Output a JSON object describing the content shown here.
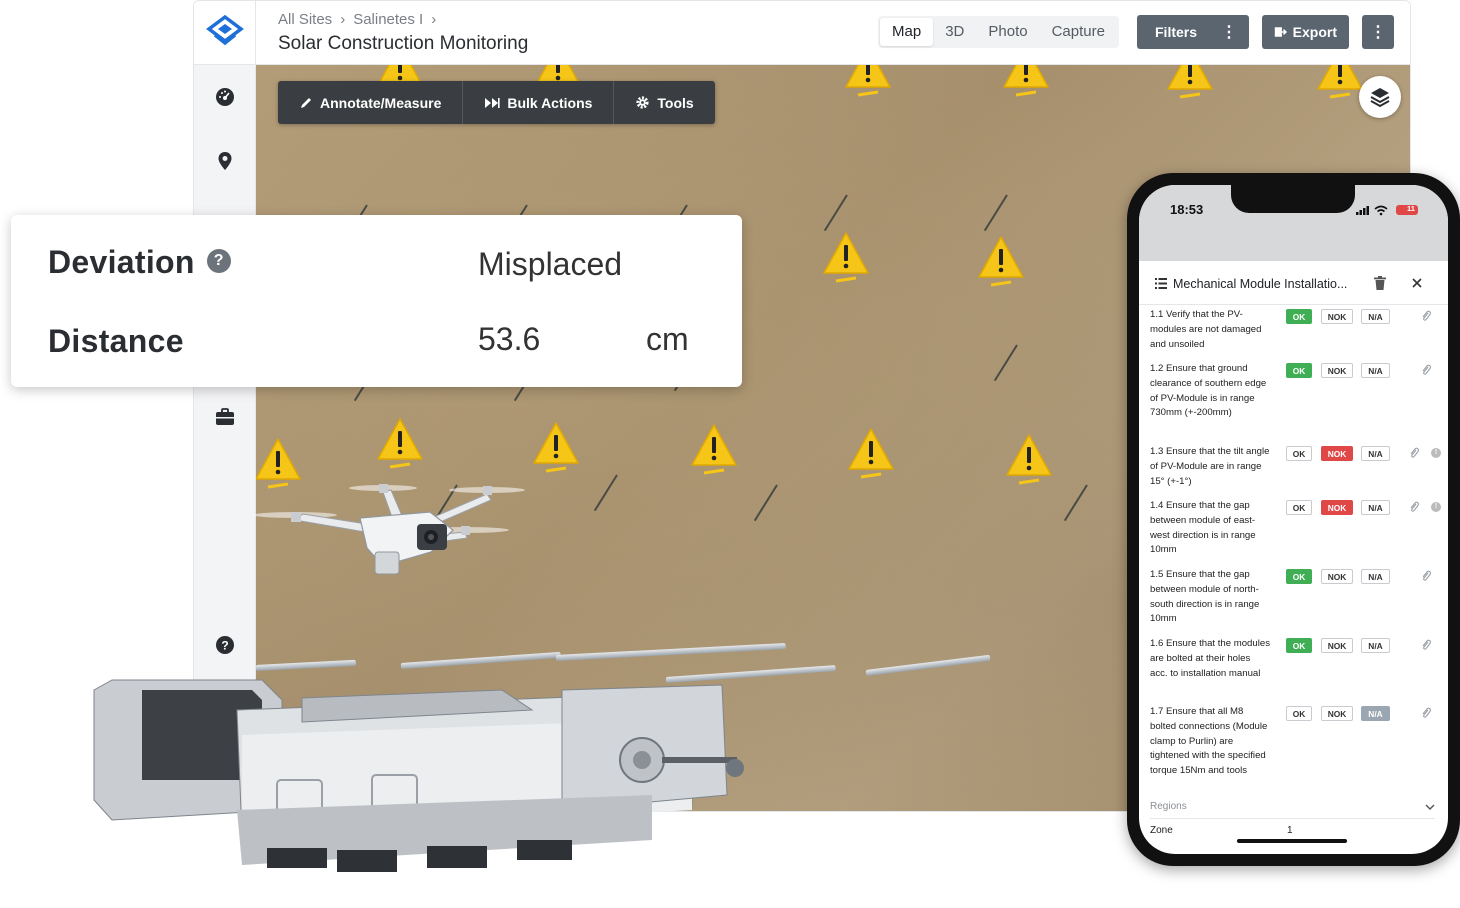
{
  "header": {
    "breadcrumb": [
      "All Sites",
      "Salinetes I"
    ],
    "title": "Solar Construction Monitoring",
    "view_tabs": [
      "Map",
      "3D",
      "Photo",
      "Capture"
    ],
    "active_tab": "Map",
    "filters_label": "Filters",
    "export_label": "Export"
  },
  "map_toolbar": {
    "annotate_label": "Annotate/Measure",
    "bulk_label": "Bulk Actions",
    "tools_label": "Tools"
  },
  "deviation_card": {
    "deviation_label": "Deviation",
    "deviation_value": "Misplaced",
    "distance_label": "Distance",
    "distance_value": "53.6",
    "distance_unit": "cm"
  },
  "phone": {
    "time": "18:53",
    "battery": "11",
    "panel_title": "Mechanical Module Installatio...",
    "items": [
      {
        "text": "1.1 Verify that the PV-modules are not damaged and unsoiled",
        "status": "ok",
        "info": false
      },
      {
        "text": "1.2 Ensure that ground clearance of southern edge of PV-Module is in range 730mm (+-200mm)",
        "status": "ok",
        "info": false
      },
      {
        "text": "1.3 Ensure that the tilt angle of PV-Module are in range 15° (+-1°)",
        "status": "nok",
        "info": true
      },
      {
        "text": "1.4 Ensure that the gap between module of east-west direction is in range 10mm",
        "status": "nok",
        "info": true
      },
      {
        "text": "1.5 Ensure that the gap between module of north-south direction is in range 10mm",
        "status": "ok",
        "info": false
      },
      {
        "text": "1.6 Ensure that the modules are bolted at their holes acc. to installation manual",
        "status": "ok",
        "info": false
      },
      {
        "text": "1.7 Ensure that all M8 bolted connections (Module clamp to Purlin) are tightened with the specified torque 15Nm and tools",
        "status": "na",
        "info": false
      }
    ],
    "chip_labels": {
      "ok": "OK",
      "nok": "NOK",
      "na": "N/A"
    },
    "regions_label": "Regions",
    "zone_label": "Zone",
    "zone_value": "1"
  },
  "colors": {
    "ok": "#3fae54",
    "nok": "#e04848",
    "na": "#9aa6b2",
    "brand": "#1f6fd8",
    "warning": "#f5c518"
  }
}
